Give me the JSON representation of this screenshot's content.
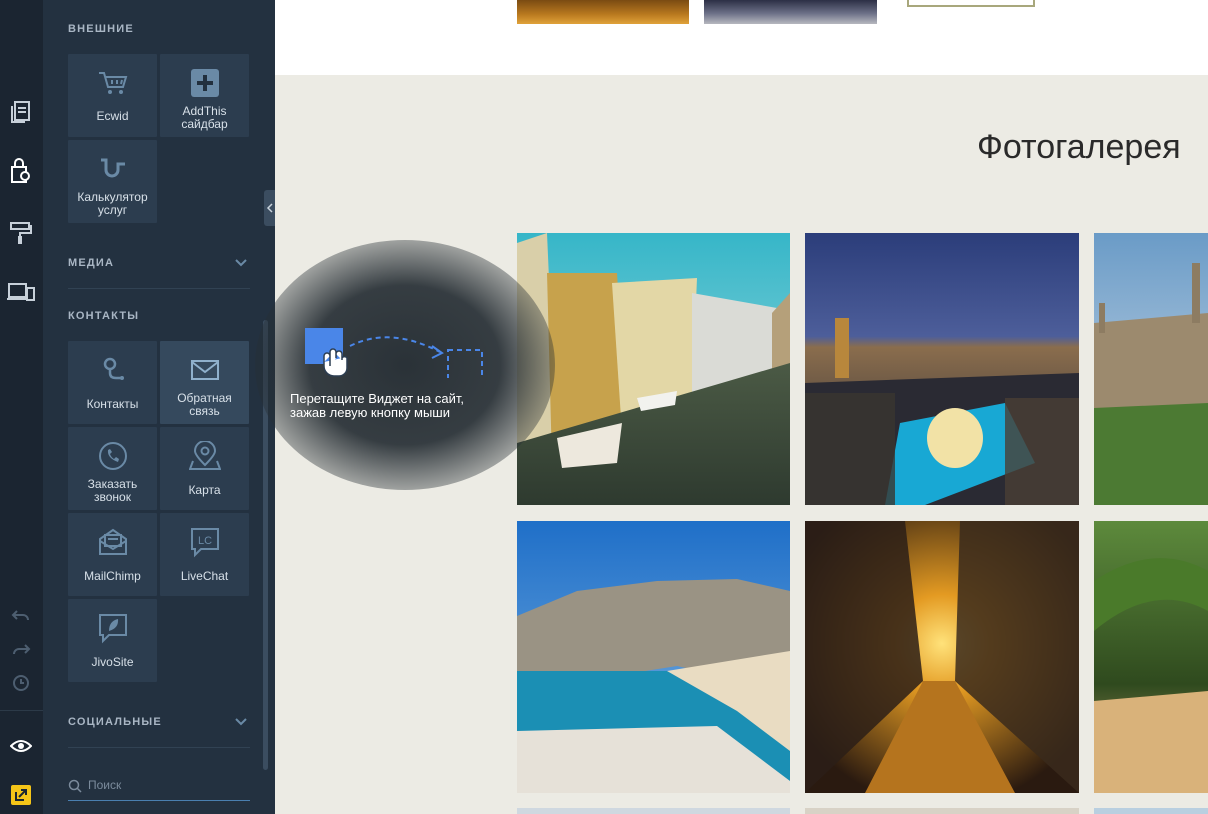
{
  "sections": {
    "external": "Внешние",
    "media": "Медиа",
    "contacts": "Контакты",
    "social": "Социальные"
  },
  "external_tiles": [
    {
      "label": "Ecwid",
      "icon": "cart-icon"
    },
    {
      "label": "AddThis сайдбар",
      "icon": "plus-square-icon"
    },
    {
      "label": "Калькулятор услуг",
      "icon": "calculator-curve-icon"
    }
  ],
  "contact_tiles": [
    {
      "label": "Контакты",
      "icon": "location-pin-icon"
    },
    {
      "label": "Обратная связь",
      "icon": "envelope-icon"
    },
    {
      "label": "Заказать звонок",
      "icon": "phone-icon"
    },
    {
      "label": "Карта",
      "icon": "map-pin-icon"
    },
    {
      "label": "MailChimp",
      "icon": "mail-letter-icon"
    },
    {
      "label": "LiveChat",
      "icon": "livechat-icon"
    },
    {
      "label": "JivoSite",
      "icon": "chat-leaf-icon"
    }
  ],
  "search": {
    "placeholder": "Поиск"
  },
  "hint": {
    "line1": "Перетащите Виджет на сайт,",
    "line2": "зажав левую кнопку мыши"
  },
  "gallery": {
    "title": "Фотогалерея"
  },
  "colors": {
    "rail": "#1b2531",
    "panel": "#233140",
    "tile": "#2c3d4f",
    "accent": "#f5c518",
    "drag_blue": "#4a86e8",
    "page_bg": "#ecebe4"
  }
}
